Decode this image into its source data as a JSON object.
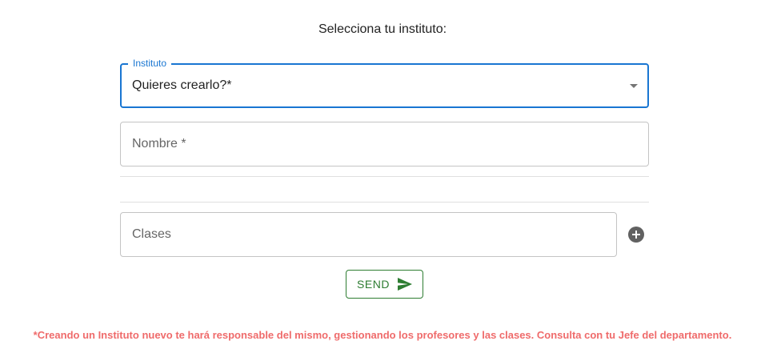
{
  "header": {
    "prompt": "Selecciona tu instituto:"
  },
  "form": {
    "instituto": {
      "label": "Instituto",
      "value": "Quieres crearlo?*"
    },
    "nombre": {
      "placeholder": "Nombre *"
    },
    "clases": {
      "placeholder": "Clases",
      "add_icon": "add-circle-icon"
    },
    "send": {
      "label": "SEND",
      "icon": "send-icon"
    }
  },
  "footer": {
    "disclaimer": "*Creando un Instituto nuevo te hará responsable del mismo, gestionando los profesores y las clases. Consulta con tu Jefe del departamento."
  },
  "colors": {
    "accent": "#1976d2",
    "send": "#2e7d32",
    "warning": "#ef6b6b"
  }
}
